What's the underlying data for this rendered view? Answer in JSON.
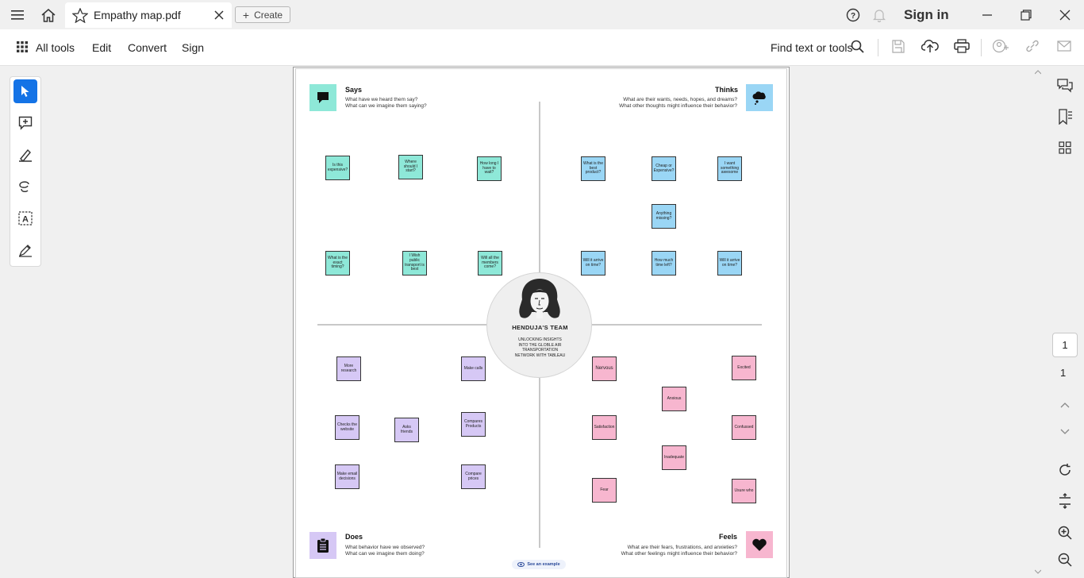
{
  "titlebar": {
    "tab_title": "Empathy map.pdf",
    "create_label": "Create",
    "signin_label": "Sign in"
  },
  "toolbar": {
    "all_tools": "All tools",
    "edit": "Edit",
    "convert": "Convert",
    "sign": "Sign",
    "find_placeholder": "Find text or tools"
  },
  "pager": {
    "current": "1",
    "total": "1"
  },
  "map": {
    "says": {
      "title": "Says",
      "line1": "What have we heard them say?",
      "line2": "What can we imagine them saying?"
    },
    "thinks": {
      "title": "Thinks",
      "line1": "What are their wants, needs, hopes, and dreams?",
      "line2": "What other thoughts might influence their behavior?"
    },
    "does": {
      "title": "Does",
      "line1": "What behavior have we observed?",
      "line2": "What can we imagine them doing?"
    },
    "feels": {
      "title": "Feels",
      "line1": "What are their fears, frustrations, and anxieties?",
      "line2": "What other feelings might influence their behavior?"
    },
    "team": "HENDUJA'S  TEAM",
    "team_sub": "UNLOCKING INSIGHTS INTO THE GLOBLE AIR TRANSPORTATION NETWORK WITH TABLEAU",
    "example": "See an example",
    "notes": {
      "says": [
        "Is this expensive?",
        "Where should I start?",
        "How long I have to wait?",
        "What is the exact timing?",
        "I Wish public transport is best",
        "Will all the members come?"
      ],
      "thinks": [
        "What is the best product?",
        "Cheap or Expensive?",
        "I want something awesome",
        "Anything missing?",
        "Will it arrive on time?",
        "How much time left?",
        "Will it arrive on  time?"
      ],
      "does": [
        "More research",
        "Make calls",
        "Checks the website",
        "Asks friends",
        "Compares Products",
        "Make email decisions",
        "Compare prices"
      ],
      "feels": [
        "Nervous",
        "Excited",
        "Anxious",
        "Satisfaction",
        "Confussed",
        "Inadequate",
        "Fear",
        "Usure who"
      ]
    }
  },
  "colors": {
    "says": "#8ee8d8",
    "thinks": "#9ad6f5",
    "does": "#d6c8f5",
    "feels": "#f7b6cf",
    "accent": "#1473e6"
  }
}
